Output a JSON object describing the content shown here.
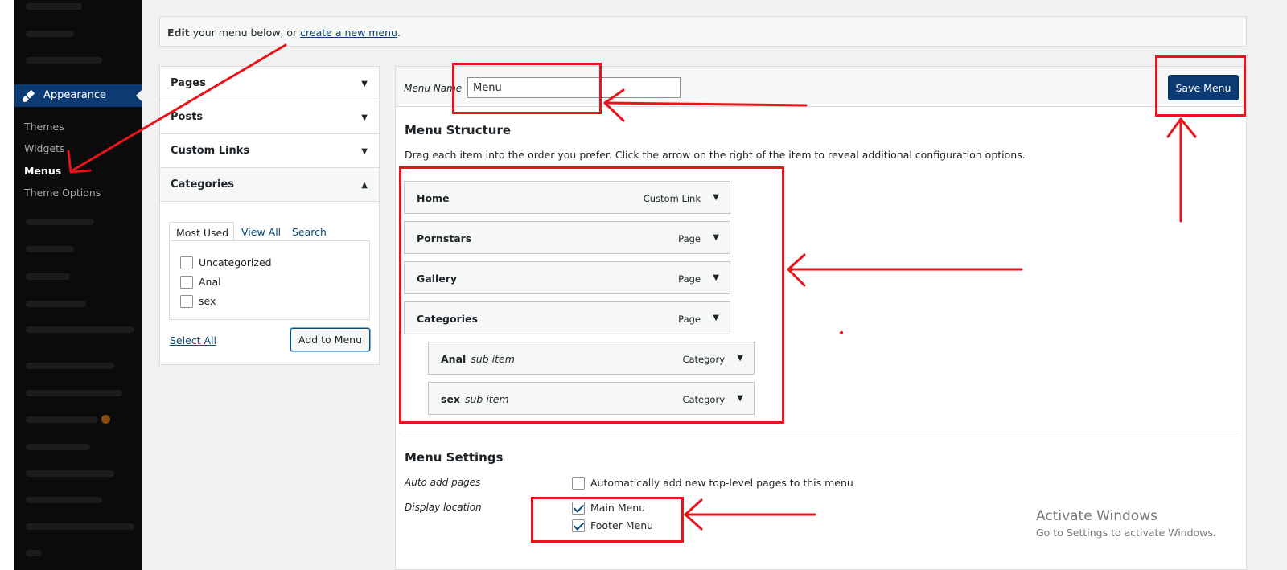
{
  "sidebar": {
    "appearance_label": "Appearance",
    "submenu": [
      "Themes",
      "Widgets",
      "Menus",
      "Theme Options"
    ]
  },
  "notice": {
    "prefix": "Edit",
    "text": " your menu below, or ",
    "link": "create a new menu",
    "suffix": "."
  },
  "accordion": {
    "pages": "Pages",
    "posts": "Posts",
    "custom_links": "Custom Links",
    "categories": "Categories"
  },
  "categories_panel": {
    "tabs": [
      "Most Used",
      "View All",
      "Search"
    ],
    "items": [
      "Uncategorized",
      "Anal",
      "sex"
    ],
    "select_all": "Select All",
    "add_button": "Add to Menu"
  },
  "menu_header": {
    "name_label": "Menu Name",
    "name_value": "Menu",
    "save_button": "Save Menu"
  },
  "structure": {
    "heading": "Menu Structure",
    "description": "Drag each item into the order you prefer. Click the arrow on the right of the item to reveal additional configuration options.",
    "items": [
      {
        "title": "Home",
        "sub": "",
        "type": "Custom Link"
      },
      {
        "title": "Pornstars",
        "sub": "",
        "type": "Page"
      },
      {
        "title": "Gallery",
        "sub": "",
        "type": "Page"
      },
      {
        "title": "Categories",
        "sub": "",
        "type": "Page"
      },
      {
        "title": "Anal",
        "sub": "sub item",
        "type": "Category"
      },
      {
        "title": "sex",
        "sub": "sub item",
        "type": "Category"
      }
    ]
  },
  "settings": {
    "heading": "Menu Settings",
    "auto_add_label": "Auto add pages",
    "auto_add_option": "Automatically add new top-level pages to this menu",
    "display_location_label": "Display location",
    "locations": [
      "Main Menu",
      "Footer Menu"
    ]
  },
  "watermark": {
    "title": "Activate Windows",
    "subtitle": "Go to Settings to activate Windows."
  },
  "colors": {
    "annotation_red": "#e8141b",
    "sidebar_active": "#0c3a72",
    "button_primary": "#0c3a72"
  }
}
